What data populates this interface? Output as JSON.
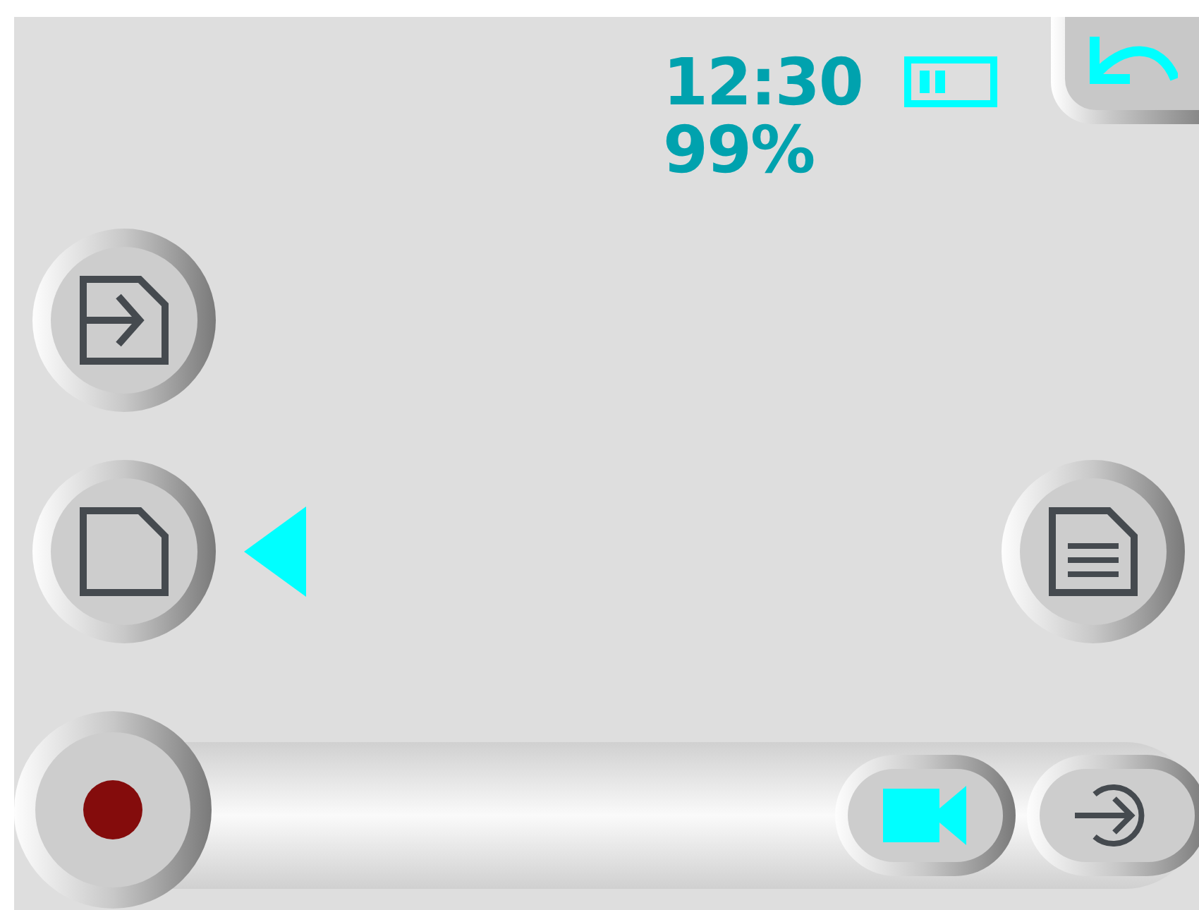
{
  "status": {
    "time": "12:30",
    "battery_percent": "99%"
  },
  "left_buttons": [
    {
      "kind": "import",
      "selected": false
    },
    {
      "kind": "file",
      "selected": true
    }
  ],
  "right_button": {
    "kind": "document"
  },
  "bottom_bar": {
    "record": {
      "kind": "record"
    },
    "buttons": [
      {
        "kind": "camera",
        "on": true
      },
      {
        "kind": "enter",
        "on": false
      }
    ]
  }
}
